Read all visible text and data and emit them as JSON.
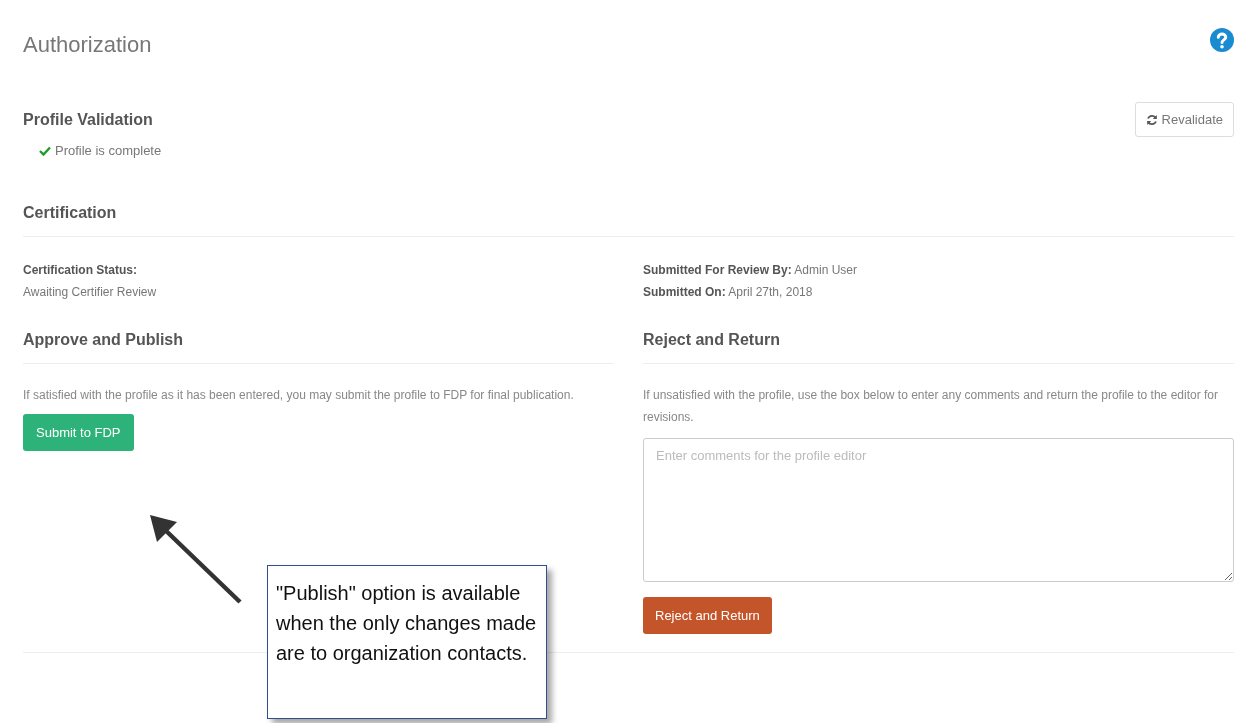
{
  "page": {
    "title": "Authorization"
  },
  "profile_validation": {
    "heading": "Profile Validation",
    "button": "Revalidate",
    "status": "Profile is complete"
  },
  "certification": {
    "heading": "Certification",
    "status_label": "Certification Status:",
    "status_value": "Awaiting Certifier Review",
    "submitted_by": "**Submitted For Review By:** Admin User",
    "submitted_on": "**Submitted On:** April 27th, 2018"
  },
  "approve": {
    "heading": "Approve and Publish",
    "text": "If satisfied with the profile as it has been entered, you may submit the profile to FDP for final publication.",
    "button": "Submit to FDP"
  },
  "reject": {
    "heading": "Reject and Return",
    "text": "If unsatisfied with the profile, use the box below to enter any comments and return the profile to the editor for revisions.",
    "placeholder": "Enter comments for the profile editor",
    "button": "Reject and Return"
  },
  "callout": {
    "text": "\"Publish\" option is available when the only changes made are to organization contacts."
  }
}
